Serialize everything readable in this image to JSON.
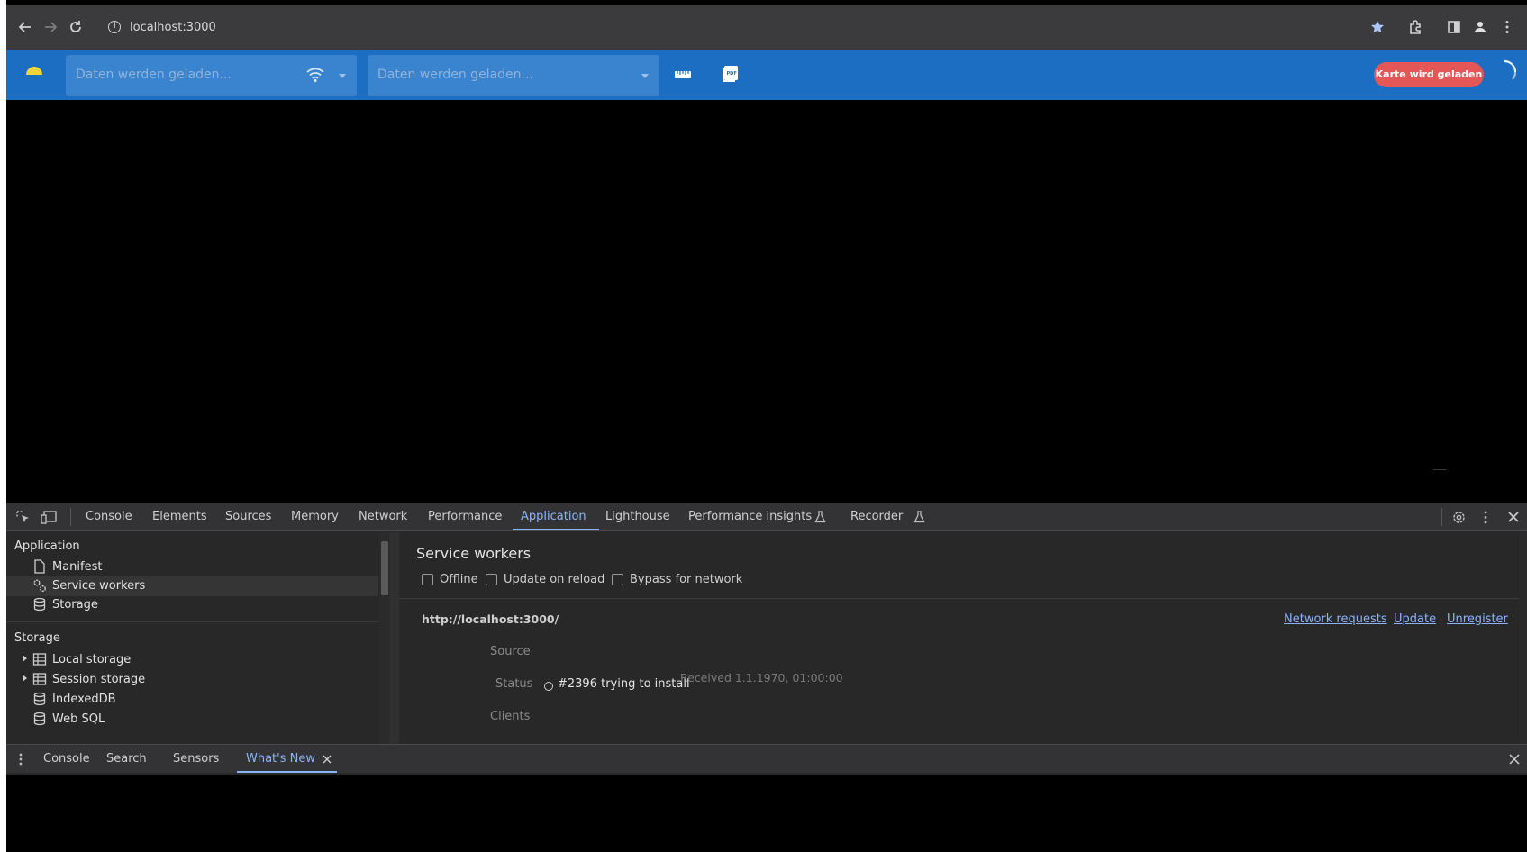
{
  "browser": {
    "url": "localhost:3000"
  },
  "app": {
    "select1_placeholder": "Daten werden geladen...",
    "select2_placeholder": "Daten werden geladen...",
    "map_status": "Karte wird geladen",
    "colors": {
      "toolbar": "#1c6ec2",
      "status_pill": "#e55757"
    }
  },
  "devtools": {
    "tabs": [
      "Console",
      "Elements",
      "Sources",
      "Memory",
      "Network",
      "Performance",
      "Application",
      "Lighthouse",
      "Performance insights",
      "Recorder"
    ],
    "active_tab": "Application",
    "sidebar": {
      "section_application": "Application",
      "app_items": [
        "Manifest",
        "Service workers",
        "Storage"
      ],
      "selected_item": "Service workers",
      "section_storage": "Storage",
      "storage_items": [
        "Local storage",
        "Session storage",
        "IndexedDB",
        "Web SQL"
      ]
    },
    "service_workers": {
      "title": "Service workers",
      "checkboxes": [
        "Offline",
        "Update on reload",
        "Bypass for network"
      ],
      "origin": "http://localhost:3000/",
      "links": [
        "Network requests",
        "Update",
        "Unregister"
      ],
      "source_label": "Source",
      "status_label": "Status",
      "status_text": "#2396 trying to install",
      "received": "Received 1.1.1970, 01:00:00",
      "clients_label": "Clients"
    },
    "drawer": {
      "tabs": [
        "Console",
        "Search",
        "Sensors",
        "What's New"
      ],
      "active_tab": "What's New"
    }
  }
}
